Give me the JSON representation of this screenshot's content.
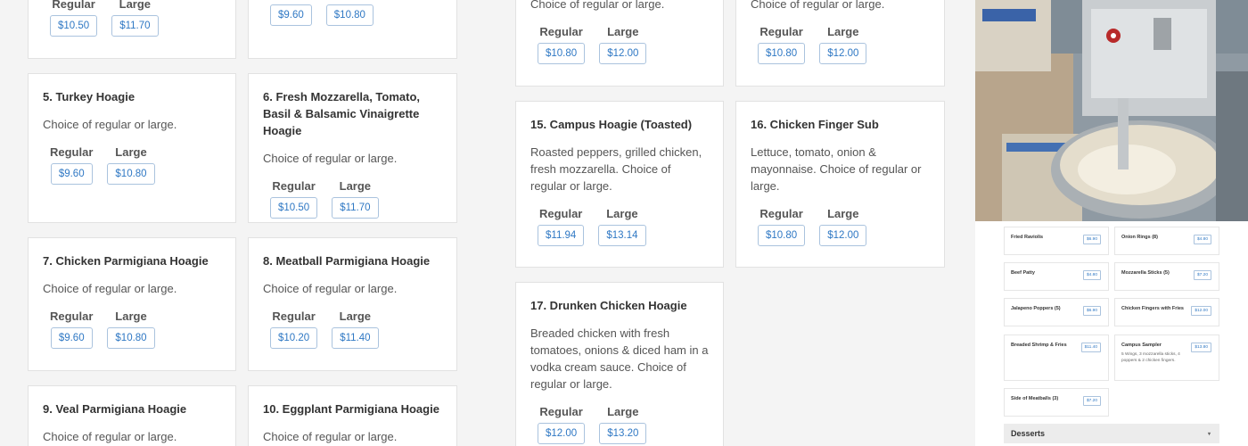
{
  "col1": {
    "top_card": {
      "labels": [
        "Regular",
        "Large"
      ],
      "prices": [
        "$10.50",
        "$11.70"
      ]
    },
    "c5": {
      "title": "5. Turkey Hoagie",
      "desc": "Choice of regular or large.",
      "labels": [
        "Regular",
        "Large"
      ],
      "prices": [
        "$9.60",
        "$10.80"
      ]
    },
    "c7": {
      "title": "7. Chicken Parmigiana Hoagie",
      "desc": "Choice of regular or large.",
      "labels": [
        "Regular",
        "Large"
      ],
      "prices": [
        "$9.60",
        "$10.80"
      ]
    },
    "c9": {
      "title": "9. Veal Parmigiana Hoagie",
      "desc": "Choice of regular or large."
    }
  },
  "col2": {
    "top_card": {
      "prices": [
        "$9.60",
        "$10.80"
      ]
    },
    "c6": {
      "title": "6. Fresh Mozzarella, Tomato, Basil & Balsamic Vinaigrette Hoagie",
      "desc": "Choice of regular or large.",
      "labels": [
        "Regular",
        "Large"
      ],
      "prices": [
        "$10.50",
        "$11.70"
      ]
    },
    "c8": {
      "title": "8. Meatball Parmigiana Hoagie",
      "desc": "Choice of regular or large.",
      "labels": [
        "Regular",
        "Large"
      ],
      "prices": [
        "$10.20",
        "$11.40"
      ]
    },
    "c10": {
      "title": "10. Eggplant Parmigiana Hoagie",
      "desc": "Choice of regular or large."
    }
  },
  "col3": {
    "top_card": {
      "desc": "Choice of regular or large.",
      "labels": [
        "Regular",
        "Large"
      ],
      "prices": [
        "$10.80",
        "$12.00"
      ]
    },
    "c15": {
      "title": "15. Campus Hoagie (Toasted)",
      "desc": "Roasted peppers, grilled chicken, fresh mozzarella. Choice of regular or large.",
      "labels": [
        "Regular",
        "Large"
      ],
      "prices": [
        "$11.94",
        "$13.14"
      ]
    },
    "c17": {
      "title": "17. Drunken Chicken Hoagie",
      "desc": "Breaded chicken with fresh tomatoes, onions & diced ham in a vodka cream sauce. Choice of regular or large.",
      "labels": [
        "Regular",
        "Large"
      ],
      "prices": [
        "$12.00",
        "$13.20"
      ]
    }
  },
  "col4": {
    "top_card": {
      "desc": "Choice of regular or large.",
      "labels": [
        "Regular",
        "Large"
      ],
      "prices": [
        "$10.80",
        "$12.00"
      ]
    },
    "c16": {
      "title": "16. Chicken Finger Sub",
      "desc": "Lettuce, tomato, onion & mayonnaise. Choice of regular or large.",
      "labels": [
        "Regular",
        "Large"
      ],
      "prices": [
        "$10.80",
        "$12.00"
      ]
    }
  },
  "side": {
    "mini_items": [
      {
        "name": "Fried Raviolis",
        "price": "$6.90"
      },
      {
        "name": "Onion Rings (8)",
        "price": "$4.80"
      },
      {
        "name": "Beef Patty",
        "price": "$4.80"
      },
      {
        "name": "Mozzarella Sticks (5)",
        "price": "$7.20"
      },
      {
        "name": "Jalapeno Poppers (5)",
        "price": "$6.90"
      },
      {
        "name": "Chicken Fingers with Fries",
        "price": "$12.00"
      },
      {
        "name": "Breaded Shrimp & Fries",
        "price": "$11.40"
      },
      {
        "name": "Campus Sampler",
        "price": "$13.80",
        "desc": "5 Wings, 3 mozzarella sticks, 4 poppers & 2 chicken fingers."
      },
      {
        "name": "Side of Meatballs (3)",
        "price": "$7.20"
      }
    ],
    "desserts_label": "Desserts",
    "desserts_chevron": "▾"
  }
}
